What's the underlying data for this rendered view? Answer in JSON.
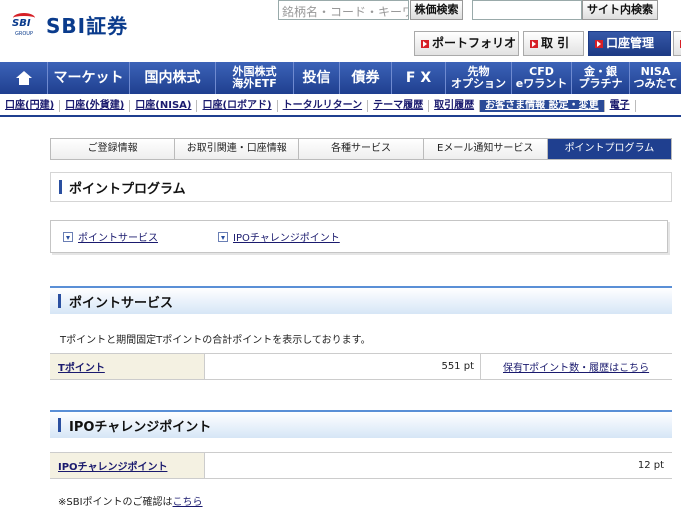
{
  "header": {
    "logo_text": "SBI証券",
    "logo_mark_text": "SBI",
    "logo_mark_sub": "GROUP",
    "search_placeholder": "銘柄名・コード・キーワード",
    "stock_search_label": "株価検索",
    "site_search_label": "サイト内検索",
    "portfolio_label": "ポートフォリオ",
    "trade_label": "取 引",
    "account_label": "口座管理"
  },
  "main_nav": [
    {
      "label": "home"
    },
    {
      "label": "マーケット"
    },
    {
      "label": "国内株式"
    },
    {
      "label": "外国株式\n海外ETF"
    },
    {
      "label": "投信"
    },
    {
      "label": "債券"
    },
    {
      "label": "F X"
    },
    {
      "label": "先物\nオプション"
    },
    {
      "label": "CFD\neワラント"
    },
    {
      "label": "金・銀\nプラチナ"
    },
    {
      "label": "NISA\nつみたて"
    }
  ],
  "sub_nav": [
    "口座(円建)",
    "口座(外貨建)",
    "口座(NISA)",
    "口座(ロボアド)",
    "トータルリターン",
    "テーマ履歴",
    "取引履歴",
    "お客さま情報 設定・変更",
    "電子"
  ],
  "tabs": [
    "ご登録情報",
    "お取引関連・口座情報",
    "各種サービス",
    "Eメール通知サービス",
    "ポイントプログラム"
  ],
  "page_title": "ポイントプログラム",
  "anchors": {
    "point_service": "ポイントサービス",
    "ipo_point": "IPOチャレンジポイント"
  },
  "section_point": {
    "title": "ポイントサービス",
    "description": "Tポイントと期間固定Tポイントの合計ポイントを表示しております。",
    "row_label": "Tポイント",
    "row_value": "551 pt",
    "row_link": "保有Tポイント数・履歴はこちら"
  },
  "section_ipo": {
    "title": "IPOチャレンジポイント",
    "row_label": "IPOチャレンジポイント",
    "row_value": "12 pt"
  },
  "note": {
    "text": "※SBIポイントのご確認は",
    "link": "こちら"
  },
  "colors": {
    "brand_navy": "#1f3f8f",
    "brand_red": "#d61f26",
    "section_border": "#5a8fd6"
  }
}
